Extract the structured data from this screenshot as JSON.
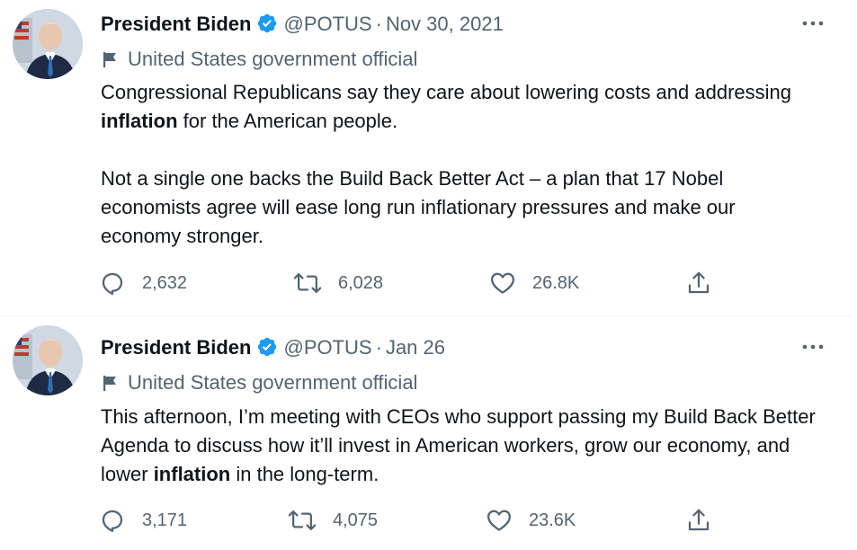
{
  "tweets": [
    {
      "author": "President Biden",
      "handle": "@POTUS",
      "separator": "·",
      "date": "Nov 30, 2021",
      "label": "United States government official",
      "body": [
        [
          {
            "t": "Congressional Republicans say they care about lowering costs and addressing ",
            "b": false
          },
          {
            "t": "inflation",
            "b": true
          },
          {
            "t": " for the American people.",
            "b": false
          }
        ],
        [
          {
            "t": "Not a single one backs the Build Back Better Act – a plan that 17 Nobel economists agree will ease long run inflationary pressures and make our economy stronger.",
            "b": false
          }
        ]
      ],
      "replies": "2,632",
      "retweets": "6,028",
      "likes": "26.8K"
    },
    {
      "author": "President Biden",
      "handle": "@POTUS",
      "separator": "·",
      "date": "Jan 26",
      "label": "United States government official",
      "body": [
        [
          {
            "t": "This afternoon, I’m meeting with CEOs who support passing my Build Back Better Agenda to discuss how it’ll invest in American workers, grow our economy, and lower ",
            "b": false
          },
          {
            "t": "inflation",
            "b": true
          },
          {
            "t": " in the long-term.",
            "b": false
          }
        ]
      ],
      "replies": "3,171",
      "retweets": "4,075",
      "likes": "23.6K"
    }
  ],
  "icons": {
    "verified": "verified-badge-icon",
    "label": "flag-icon",
    "more": "more-icon",
    "reply": "reply-icon",
    "retweet": "retweet-icon",
    "like": "heart-icon",
    "share": "share-icon"
  },
  "colors": {
    "verified": "#1d9bf0",
    "text": "#0f1419",
    "muted": "#536471",
    "divider": "#eff3f4"
  }
}
